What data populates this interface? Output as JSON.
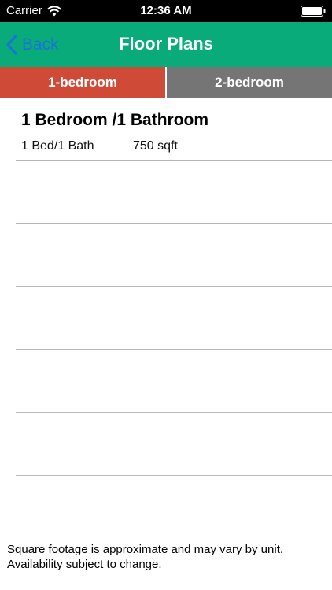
{
  "status_bar": {
    "carrier": "Carrier",
    "time": "12:36 AM",
    "wifi_icon": "wifi-icon",
    "battery_icon": "battery-icon"
  },
  "nav": {
    "back_label": "Back",
    "back_icon": "chevron-left-icon",
    "title": "Floor Plans",
    "background_color": "#0aab7b"
  },
  "tabs": [
    {
      "label": "1-bedroom",
      "selected": true,
      "color": "#cf4a37"
    },
    {
      "label": "2-bedroom",
      "selected": false,
      "color": "#757575"
    }
  ],
  "plans": [
    {
      "title": "1 Bedroom /1 Bathroom",
      "beds": "1 Bed/1 Bath",
      "sqft": "750 sqft"
    },
    {
      "title": "",
      "beds": "",
      "sqft": ""
    },
    {
      "title": "",
      "beds": "",
      "sqft": ""
    },
    {
      "title": "",
      "beds": "",
      "sqft": ""
    },
    {
      "title": "",
      "beds": "",
      "sqft": ""
    },
    {
      "title": "",
      "beds": "",
      "sqft": ""
    }
  ],
  "footer": {
    "disclaimer_line1": "Square footage is approximate and may vary by unit.",
    "disclaimer_line2": "Availability subject to change."
  }
}
